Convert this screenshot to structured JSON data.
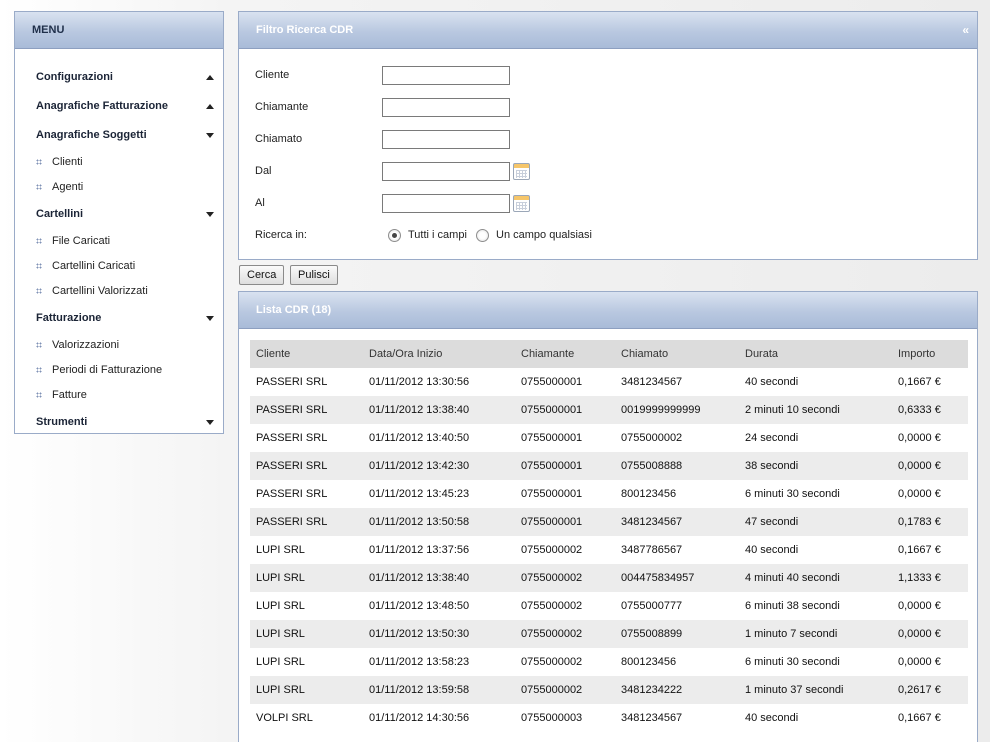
{
  "sidebar": {
    "title": "MENU",
    "entries": [
      {
        "type": "group",
        "label": "Configurazioni",
        "caret": "up"
      },
      {
        "type": "group",
        "label": "Anagrafiche Fatturazione",
        "caret": "up"
      },
      {
        "type": "group",
        "label": "Anagrafiche Soggetti",
        "caret": "down"
      },
      {
        "type": "item",
        "label": "Clienti"
      },
      {
        "type": "item",
        "label": "Agenti"
      },
      {
        "type": "group",
        "label": "Cartellini",
        "caret": "down"
      },
      {
        "type": "item",
        "label": "File Caricati"
      },
      {
        "type": "item",
        "label": "Cartellini Caricati"
      },
      {
        "type": "item",
        "label": "Cartellini Valorizzati"
      },
      {
        "type": "group",
        "label": "Fatturazione",
        "caret": "down"
      },
      {
        "type": "item",
        "label": "Valorizzazioni"
      },
      {
        "type": "item",
        "label": "Periodi di Fatturazione"
      },
      {
        "type": "item",
        "label": "Fatture"
      },
      {
        "type": "group",
        "label": "Strumenti",
        "caret": "down"
      }
    ]
  },
  "filter": {
    "title": "Filtro Ricerca CDR",
    "collapse_glyph": "«",
    "fields": {
      "cliente": {
        "label": "Cliente",
        "value": ""
      },
      "chiamante": {
        "label": "Chiamante",
        "value": ""
      },
      "chiamato": {
        "label": "Chiamato",
        "value": ""
      },
      "dal": {
        "label": "Dal",
        "value": ""
      },
      "al": {
        "label": "Al",
        "value": ""
      }
    },
    "search_in": {
      "label": "Ricerca in:",
      "options": [
        "Tutti i campi",
        "Un campo qualsiasi"
      ],
      "selected": "Tutti i campi"
    }
  },
  "buttons": {
    "search": "Cerca",
    "clear": "Pulisci"
  },
  "list": {
    "title": "Lista CDR (18)",
    "columns": [
      "Cliente",
      "Data/Ora Inizio",
      "Chiamante",
      "Chiamato",
      "Durata",
      "Importo"
    ],
    "rows": [
      [
        "PASSERI SRL",
        "01/11/2012 13:30:56",
        "0755000001",
        "3481234567",
        "40 secondi",
        "0,1667 €"
      ],
      [
        "PASSERI SRL",
        "01/11/2012 13:38:40",
        "0755000001",
        "0019999999999",
        "2 minuti 10 secondi",
        "0,6333 €"
      ],
      [
        "PASSERI SRL",
        "01/11/2012 13:40:50",
        "0755000001",
        "0755000002",
        "24 secondi",
        "0,0000 €"
      ],
      [
        "PASSERI SRL",
        "01/11/2012 13:42:30",
        "0755000001",
        "0755008888",
        "38 secondi",
        "0,0000 €"
      ],
      [
        "PASSERI SRL",
        "01/11/2012 13:45:23",
        "0755000001",
        "800123456",
        "6 minuti 30 secondi",
        "0,0000 €"
      ],
      [
        "PASSERI SRL",
        "01/11/2012 13:50:58",
        "0755000001",
        "3481234567",
        "47 secondi",
        "0,1783 €"
      ],
      [
        "LUPI SRL",
        "01/11/2012 13:37:56",
        "0755000002",
        "3487786567",
        "40 secondi",
        "0,1667 €"
      ],
      [
        "LUPI SRL",
        "01/11/2012 13:38:40",
        "0755000002",
        "004475834957",
        "4 minuti 40 secondi",
        "1,1333 €"
      ],
      [
        "LUPI SRL",
        "01/11/2012 13:48:50",
        "0755000002",
        "0755000777",
        "6 minuti 38 secondi",
        "0,0000 €"
      ],
      [
        "LUPI SRL",
        "01/11/2012 13:50:30",
        "0755000002",
        "0755008899",
        "1 minuto 7 secondi",
        "0,0000 €"
      ],
      [
        "LUPI SRL",
        "01/11/2012 13:58:23",
        "0755000002",
        "800123456",
        "6 minuti 30 secondi",
        "0,0000 €"
      ],
      [
        "LUPI SRL",
        "01/11/2012 13:59:58",
        "0755000002",
        "3481234222",
        "1 minuto 37 secondi",
        "0,2617 €"
      ],
      [
        "VOLPI SRL",
        "01/11/2012 14:30:56",
        "0755000003",
        "3481234567",
        "40 secondi",
        "0,1667 €"
      ]
    ]
  }
}
